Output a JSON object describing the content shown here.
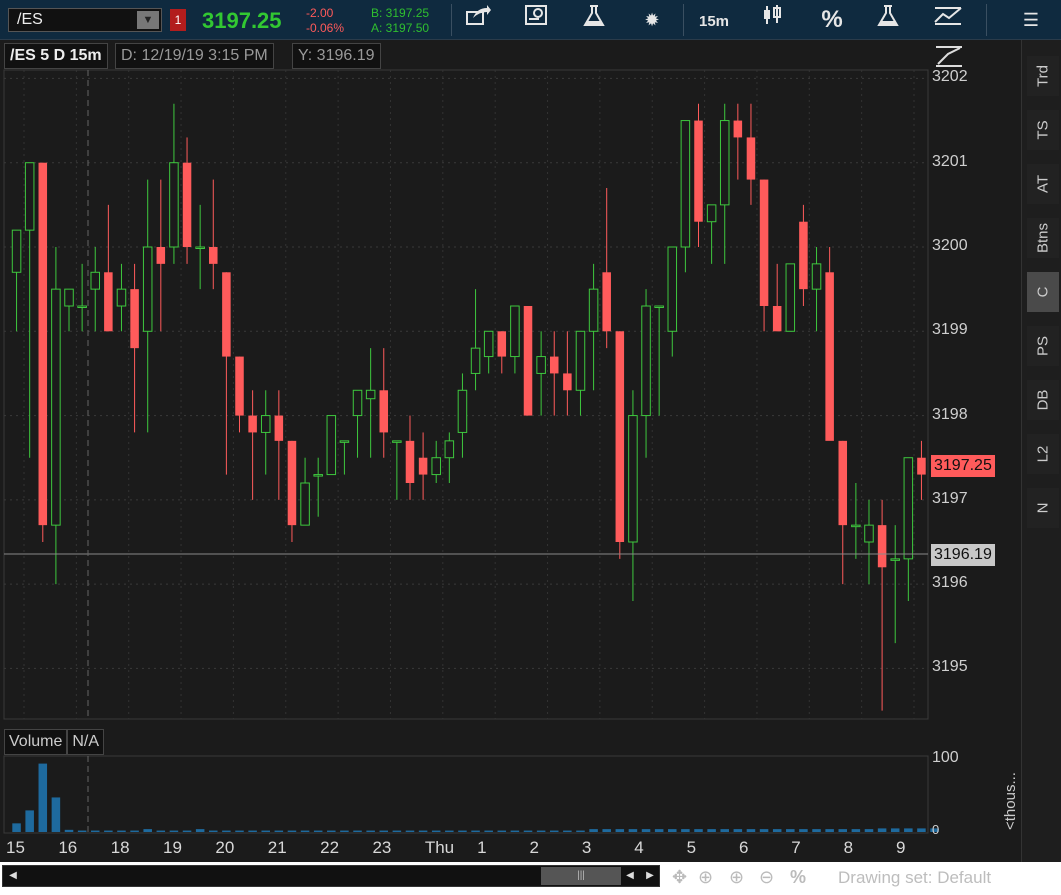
{
  "toolbar": {
    "symbol": "/ES",
    "flag": "1",
    "last_price": "3197.25",
    "change": "-2.00",
    "change_pct": "-0.06%",
    "bid": "B: 3197.25",
    "ask": "A: 3197.50",
    "interval": "15m",
    "percent_label": "%",
    "icons": [
      "share-icon",
      "info-icon",
      "flask-icon",
      "gear-icon",
      "candle-style-icon",
      "flask-icon",
      "drawing-icon",
      "menu-icon"
    ]
  },
  "chart": {
    "symbol_label": "/ES 5 D 15m",
    "date_label": "D: 12/19/19 3:15 PM",
    "y_label": "Y: 3196.19",
    "last_tag": "3197.25",
    "cursor_tag": "3196.19",
    "price_axis": [
      "3202",
      "3201",
      "3200",
      "3199",
      "3198",
      "3197",
      "3196",
      "3195"
    ],
    "volume_label": "Volume",
    "volume_value": "N/A",
    "volume_axis_top": "100",
    "volume_axis_zero": "0",
    "volume_units": "<thous...",
    "x_axis": [
      "15",
      "16",
      "18",
      "19",
      "20",
      "21",
      "22",
      "23",
      "Thu",
      "1",
      "2",
      "3",
      "4",
      "5",
      "6",
      "7",
      "8",
      "9"
    ],
    "colors": {
      "up": "#3ec83e",
      "down": "#ff5b5b",
      "volume": "#1e6a9e",
      "last_tag_bg": "#ff5b5b",
      "cursor_tag_bg": "#c8c8c8"
    }
  },
  "chart_data": {
    "type": "candlestick",
    "ylim": [
      3194.4,
      3202.1
    ],
    "candles": [
      {
        "o": 3199.7,
        "h": 3200.0,
        "l": 3199.0,
        "c": 3200.2
      },
      {
        "o": 3200.2,
        "h": 3201.0,
        "l": 3197.5,
        "c": 3201.0
      },
      {
        "o": 3201.0,
        "h": 3201.0,
        "l": 3196.5,
        "c": 3196.7
      },
      {
        "o": 3196.7,
        "h": 3200.0,
        "l": 3196.0,
        "c": 3199.5
      },
      {
        "o": 3199.3,
        "h": 3199.5,
        "l": 3199.0,
        "c": 3199.5
      },
      {
        "o": 3199.3,
        "h": 3199.8,
        "l": 3199.0,
        "c": 3199.3
      },
      {
        "o": 3199.5,
        "h": 3200.0,
        "l": 3199.0,
        "c": 3199.7
      },
      {
        "o": 3199.7,
        "h": 3200.5,
        "l": 3199.0,
        "c": 3199.0
      },
      {
        "o": 3199.3,
        "h": 3199.8,
        "l": 3199.0,
        "c": 3199.5
      },
      {
        "o": 3199.5,
        "h": 3199.8,
        "l": 3197.8,
        "c": 3198.8
      },
      {
        "o": 3199.0,
        "h": 3200.8,
        "l": 3197.8,
        "c": 3200.0
      },
      {
        "o": 3200.0,
        "h": 3200.8,
        "l": 3199.0,
        "c": 3199.8
      },
      {
        "o": 3200.0,
        "h": 3201.7,
        "l": 3199.8,
        "c": 3201.0
      },
      {
        "o": 3201.0,
        "h": 3201.3,
        "l": 3199.8,
        "c": 3200.0
      },
      {
        "o": 3200.0,
        "h": 3200.5,
        "l": 3199.5,
        "c": 3200.0
      },
      {
        "o": 3200.0,
        "h": 3200.8,
        "l": 3199.5,
        "c": 3199.8
      },
      {
        "o": 3199.7,
        "h": 3199.7,
        "l": 3197.3,
        "c": 3198.7
      },
      {
        "o": 3198.7,
        "h": 3198.7,
        "l": 3197.8,
        "c": 3198.0
      },
      {
        "o": 3198.0,
        "h": 3198.3,
        "l": 3197.0,
        "c": 3197.8
      },
      {
        "o": 3197.8,
        "h": 3198.3,
        "l": 3197.3,
        "c": 3198.0
      },
      {
        "o": 3198.0,
        "h": 3198.3,
        "l": 3197.0,
        "c": 3197.7
      },
      {
        "o": 3197.7,
        "h": 3197.7,
        "l": 3196.5,
        "c": 3196.7
      },
      {
        "o": 3196.7,
        "h": 3197.5,
        "l": 3196.7,
        "c": 3197.2
      },
      {
        "o": 3197.3,
        "h": 3197.5,
        "l": 3196.8,
        "c": 3197.3
      },
      {
        "o": 3197.3,
        "h": 3198.0,
        "l": 3197.3,
        "c": 3198.0
      },
      {
        "o": 3197.7,
        "h": 3197.7,
        "l": 3197.3,
        "c": 3197.7
      },
      {
        "o": 3198.0,
        "h": 3198.3,
        "l": 3197.5,
        "c": 3198.3
      },
      {
        "o": 3198.2,
        "h": 3198.8,
        "l": 3197.5,
        "c": 3198.3
      },
      {
        "o": 3198.3,
        "h": 3198.8,
        "l": 3197.5,
        "c": 3197.8
      },
      {
        "o": 3197.7,
        "h": 3197.7,
        "l": 3197.0,
        "c": 3197.7
      },
      {
        "o": 3197.7,
        "h": 3198.0,
        "l": 3197.0,
        "c": 3197.2
      },
      {
        "o": 3197.5,
        "h": 3197.8,
        "l": 3197.0,
        "c": 3197.3
      },
      {
        "o": 3197.3,
        "h": 3197.7,
        "l": 3197.2,
        "c": 3197.5
      },
      {
        "o": 3197.5,
        "h": 3197.8,
        "l": 3197.2,
        "c": 3197.7
      },
      {
        "o": 3197.8,
        "h": 3198.5,
        "l": 3197.5,
        "c": 3198.3
      },
      {
        "o": 3198.5,
        "h": 3199.5,
        "l": 3198.3,
        "c": 3198.8
      },
      {
        "o": 3198.7,
        "h": 3199.0,
        "l": 3198.5,
        "c": 3199.0
      },
      {
        "o": 3199.0,
        "h": 3199.0,
        "l": 3198.5,
        "c": 3198.7
      },
      {
        "o": 3198.7,
        "h": 3199.3,
        "l": 3198.5,
        "c": 3199.3
      },
      {
        "o": 3199.3,
        "h": 3199.3,
        "l": 3198.0,
        "c": 3198.0
      },
      {
        "o": 3198.5,
        "h": 3199.0,
        "l": 3198.0,
        "c": 3198.7
      },
      {
        "o": 3198.7,
        "h": 3199.0,
        "l": 3198.0,
        "c": 3198.5
      },
      {
        "o": 3198.5,
        "h": 3199.0,
        "l": 3198.0,
        "c": 3198.3
      },
      {
        "o": 3198.3,
        "h": 3199.0,
        "l": 3198.0,
        "c": 3199.0
      },
      {
        "o": 3199.0,
        "h": 3199.8,
        "l": 3198.3,
        "c": 3199.5
      },
      {
        "o": 3199.7,
        "h": 3200.7,
        "l": 3198.8,
        "c": 3199.0
      },
      {
        "o": 3199.0,
        "h": 3199.0,
        "l": 3196.3,
        "c": 3196.5
      },
      {
        "o": 3196.5,
        "h": 3198.3,
        "l": 3195.8,
        "c": 3198.0
      },
      {
        "o": 3198.0,
        "h": 3199.5,
        "l": 3197.5,
        "c": 3199.3
      },
      {
        "o": 3199.3,
        "h": 3199.3,
        "l": 3198.0,
        "c": 3199.3
      },
      {
        "o": 3199.0,
        "h": 3199.7,
        "l": 3198.7,
        "c": 3200.0
      },
      {
        "o": 3200.0,
        "h": 3201.2,
        "l": 3199.7,
        "c": 3201.5
      },
      {
        "o": 3201.5,
        "h": 3201.7,
        "l": 3200.0,
        "c": 3200.3
      },
      {
        "o": 3200.3,
        "h": 3200.5,
        "l": 3199.8,
        "c": 3200.5
      },
      {
        "o": 3200.5,
        "h": 3201.7,
        "l": 3199.8,
        "c": 3201.5
      },
      {
        "o": 3201.5,
        "h": 3201.7,
        "l": 3200.8,
        "c": 3201.3
      },
      {
        "o": 3201.3,
        "h": 3201.7,
        "l": 3200.5,
        "c": 3200.8
      },
      {
        "o": 3200.8,
        "h": 3200.8,
        "l": 3199.0,
        "c": 3199.3
      },
      {
        "o": 3199.3,
        "h": 3199.8,
        "l": 3199.0,
        "c": 3199.0
      },
      {
        "o": 3199.0,
        "h": 3199.8,
        "l": 3199.0,
        "c": 3199.8
      },
      {
        "o": 3200.3,
        "h": 3200.5,
        "l": 3199.3,
        "c": 3199.5
      },
      {
        "o": 3199.5,
        "h": 3200.0,
        "l": 3199.0,
        "c": 3199.8
      },
      {
        "o": 3199.7,
        "h": 3200.0,
        "l": 3197.8,
        "c": 3197.7
      },
      {
        "o": 3197.7,
        "h": 3197.7,
        "l": 3196.0,
        "c": 3196.7
      },
      {
        "o": 3196.7,
        "h": 3197.2,
        "l": 3196.3,
        "c": 3196.7
      },
      {
        "o": 3196.5,
        "h": 3197.0,
        "l": 3196.0,
        "c": 3196.7
      },
      {
        "o": 3196.7,
        "h": 3197.0,
        "l": 3194.5,
        "c": 3196.2
      },
      {
        "o": 3196.3,
        "h": 3196.7,
        "l": 3195.3,
        "c": 3196.3
      },
      {
        "o": 3196.3,
        "h": 3197.5,
        "l": 3195.8,
        "c": 3197.5
      },
      {
        "o": 3197.5,
        "h": 3197.7,
        "l": 3197.0,
        "c": 3197.3
      }
    ],
    "volume": [
      12,
      30,
      95,
      48,
      3,
      2,
      2,
      2,
      2,
      2,
      4,
      2,
      2,
      2,
      4,
      2,
      2,
      2,
      2,
      2,
      2,
      2,
      2,
      2,
      2,
      2,
      2,
      2,
      2,
      2,
      2,
      2,
      2,
      2,
      2,
      2,
      2,
      2,
      2,
      2,
      2,
      2,
      2,
      2,
      4,
      4,
      4,
      4,
      4,
      4,
      4,
      4,
      4,
      4,
      4,
      4,
      4,
      4,
      4,
      4,
      4,
      4,
      4,
      4,
      4,
      4,
      5,
      5,
      5,
      5,
      5
    ],
    "volume_ylim": [
      0,
      100
    ]
  },
  "sidebar": {
    "tabs": [
      "Trd",
      "TS",
      "AT",
      "Btns",
      "C",
      "PS",
      "DB",
      "L2",
      "N"
    ],
    "active": "C"
  },
  "bottom": {
    "drawing_set": "Drawing set: Default",
    "percent_label": "%",
    "thumb_glyph": "|||"
  }
}
